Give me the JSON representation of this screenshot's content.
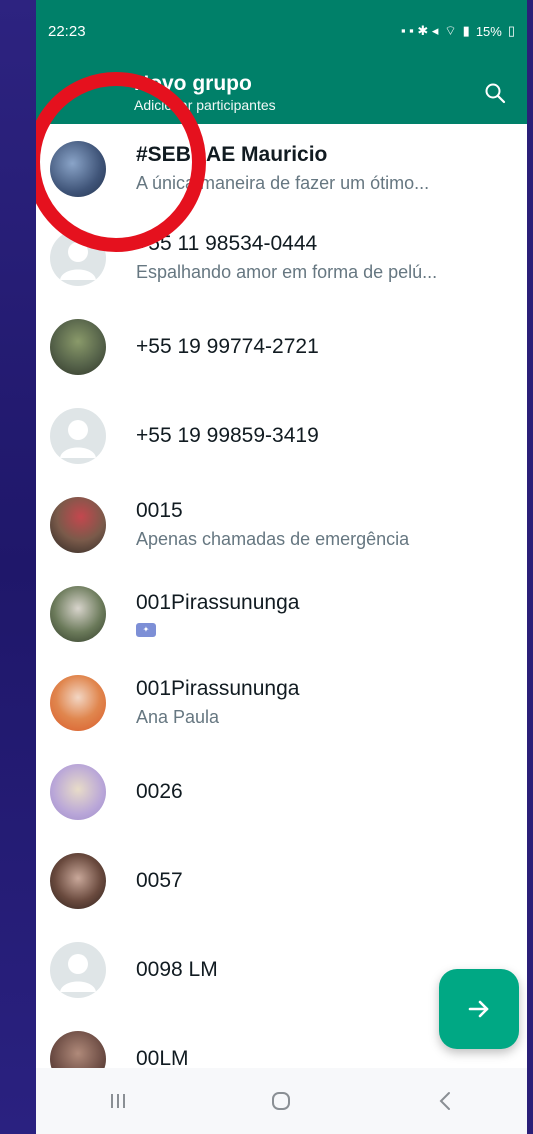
{
  "status_bar": {
    "time": "22:23",
    "battery": "15%"
  },
  "appbar": {
    "title": "Novo grupo",
    "subtitle": "Adicionar participantes"
  },
  "contacts": [
    {
      "name": "#SEBRAE Mauricio",
      "status": "A única maneira de fazer um ótimo..."
    },
    {
      "name": "+55 11 98534-0444",
      "status": "Espalhando amor em forma de pelú..."
    },
    {
      "name": "+55 19 99774-2721",
      "status": ""
    },
    {
      "name": "+55 19 99859-3419",
      "status": ""
    },
    {
      "name": "0015",
      "status": "Apenas chamadas de emergência"
    },
    {
      "name": "001Pirassununga",
      "status": ""
    },
    {
      "name": "001Pirassununga",
      "status": "Ana Paula"
    },
    {
      "name": "0026",
      "status": ""
    },
    {
      "name": "0057",
      "status": ""
    },
    {
      "name": "0098 LM",
      "status": ""
    },
    {
      "name": "00LM",
      "status": ""
    }
  ],
  "colors": {
    "header": "#008069",
    "fab": "#00a884",
    "annotation": "#e5111e"
  }
}
